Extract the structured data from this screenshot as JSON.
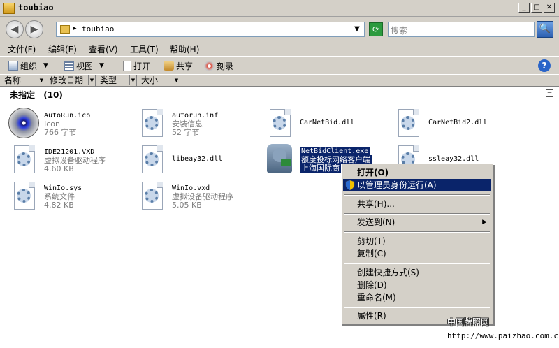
{
  "window": {
    "title": "toubiao"
  },
  "address": {
    "path": "toubiao",
    "search_placeholder": "搜索"
  },
  "menubar": [
    "文件(F)",
    "编辑(E)",
    "查看(V)",
    "工具(T)",
    "帮助(H)"
  ],
  "toolbar": {
    "organize": "组织",
    "views": "视图",
    "open": "打开",
    "share": "共享",
    "burn": "刻录"
  },
  "columns": [
    "名称",
    "修改日期",
    "类型",
    "大小"
  ],
  "group": {
    "label": "未指定",
    "count": "(10)"
  },
  "files": [
    {
      "name": "AutoRun.ico",
      "type": "Icon",
      "size": "766 字节"
    },
    {
      "name": "autorun.inf",
      "type": "安装信息",
      "size": "52 字节"
    },
    {
      "name": "CarNetBid.dll",
      "type": "",
      "size": ""
    },
    {
      "name": "CarNetBid2.dll",
      "type": "",
      "size": ""
    },
    {
      "name": "IDE21201.VXD",
      "type": "虚拟设备驱动程序",
      "size": "4.60 KB"
    },
    {
      "name": "libeay32.dll",
      "type": "",
      "size": ""
    },
    {
      "name": "NetBidClient.exe",
      "type": "额度投标网络客户端",
      "size": "上海国际商"
    },
    {
      "name": "ssleay32.dll",
      "type": "",
      "size": ""
    },
    {
      "name": "WinIo.sys",
      "type": "系统文件",
      "size": "4.82 KB"
    },
    {
      "name": "WinIo.vxd",
      "type": "虚拟设备驱动程序",
      "size": "5.05 KB"
    }
  ],
  "context_menu": {
    "open": "打开(O)",
    "run_as_admin": "以管理员身份运行(A)",
    "share": "共享(H)...",
    "send_to": "发送到(N)",
    "cut": "剪切(T)",
    "copy": "复制(C)",
    "create_shortcut": "创建快捷方式(S)",
    "delete": "删除(D)",
    "rename": "重命名(M)",
    "properties": "属性(R)"
  },
  "watermark": {
    "cn": "中国牌照网",
    "url": "http://www.paizhao.com.cn"
  }
}
